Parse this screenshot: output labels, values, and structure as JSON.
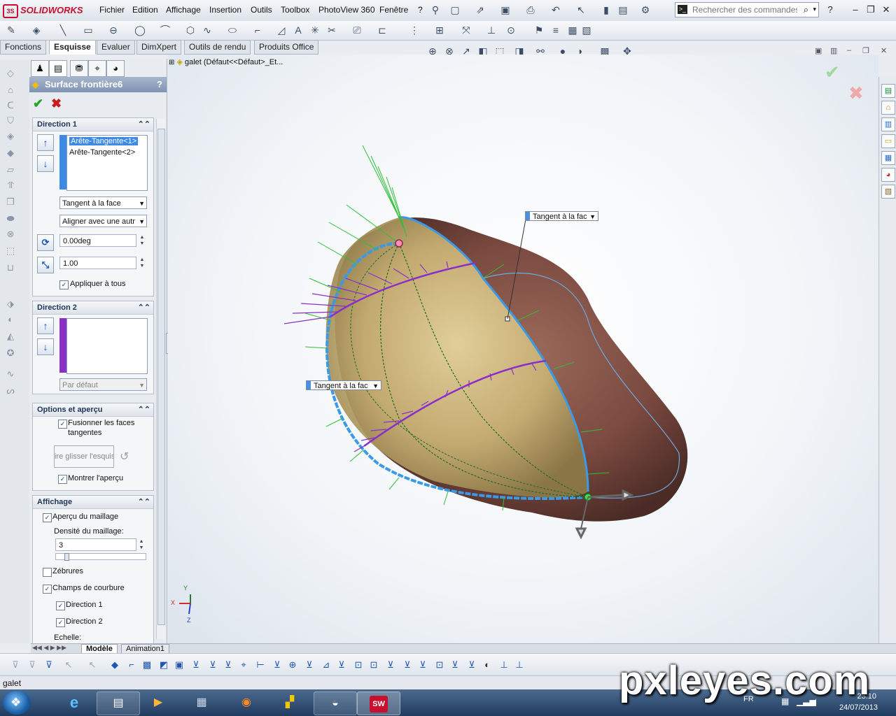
{
  "app": {
    "logo": "SOLIDWORKS"
  },
  "menu": [
    "Fichier",
    "Edition",
    "Affichage",
    "Insertion",
    "Outils",
    "Toolbox",
    "PhotoView 360",
    "Fenêtre",
    "?"
  ],
  "search": {
    "placeholder": "Rechercher des commandes"
  },
  "tabs": [
    "Fonctions",
    "Esquisse",
    "Evaluer",
    "DimXpert",
    "Outils de rendu",
    "Produits Office"
  ],
  "active_tab": "Esquisse",
  "tree": {
    "root": "galet  (Défaut<<Défaut>_Et..."
  },
  "property_manager": {
    "title": "Surface frontière6",
    "help": "?",
    "direction1": {
      "header": "Direction 1",
      "items": [
        "Arête-Tangente<1>",
        "Arête-Tangente<2>"
      ],
      "tangency": "Tangent à la face",
      "align": "Aligner avec une autr",
      "angle": "0.00deg",
      "length": "1.00",
      "apply_all": "Appliquer à tous"
    },
    "direction2": {
      "header": "Direction 2",
      "default": "Par défaut"
    },
    "options": {
      "header": "Options et aperçu",
      "merge_line1": "Fusionner les faces",
      "merge_line2": "tangentes",
      "drag_sketch": "ire glisser l'esquis",
      "show_preview": "Montrer l'aperçu"
    },
    "display": {
      "header": "Affichage",
      "mesh_preview": "Aperçu du maillage",
      "mesh_density_label": "Densité du maillage:",
      "mesh_density_value": "3",
      "zebra": "Zébrures",
      "curvature": "Champs de courbure",
      "dir1": "Direction 1",
      "dir2": "Direction 2",
      "scale": "Echelle:"
    }
  },
  "viewport": {
    "callout1": "Tangent à la fac",
    "callout2": "Tangent à la fac",
    "axes": {
      "y": "Y",
      "x": "X",
      "z": "Z"
    }
  },
  "bottom_tabs": [
    "Modèle",
    "Animation1"
  ],
  "status": "galet",
  "taskbar": {
    "lang": "FR",
    "time": "23:10",
    "date": "24/07/2013"
  },
  "watermark": "pxleyes.com",
  "colors": {
    "accent": "#3d8ae6",
    "boundary": "#3b9ae6",
    "curv_dir1": "#2fbf3a",
    "curv_dir2": "#8b2fc9"
  }
}
